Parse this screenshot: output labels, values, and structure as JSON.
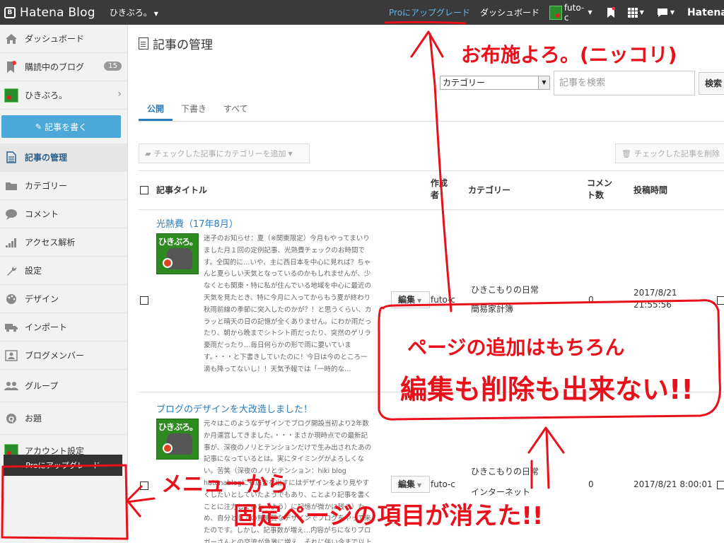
{
  "topbar": {
    "logo": "Hatena Blog",
    "blog_name": "ひきぶろ。",
    "pro_link": "Proにアップグレード",
    "dashboard_link": "ダッシュボード",
    "user": "futo-c",
    "hatena_text": "Hatena"
  },
  "sidebar": {
    "items": [
      {
        "label": "ダッシュボード",
        "icon": "home-icon"
      },
      {
        "label": "購読中のブログ",
        "icon": "bookmark-icon",
        "badge": "15"
      },
      {
        "label": "ひきぶろ。",
        "icon": "blog-avatar-icon"
      },
      {
        "label": "記事の管理",
        "icon": "document-icon"
      },
      {
        "label": "カテゴリー",
        "icon": "folder-icon"
      },
      {
        "label": "コメント",
        "icon": "comment-icon"
      },
      {
        "label": "アクセス解析",
        "icon": "chart-icon"
      },
      {
        "label": "設定",
        "icon": "wrench-icon"
      },
      {
        "label": "デザイン",
        "icon": "palette-icon"
      },
      {
        "label": "インポート",
        "icon": "truck-icon"
      },
      {
        "label": "ブログメンバー",
        "icon": "member-icon"
      },
      {
        "label": "グループ",
        "icon": "group-icon"
      },
      {
        "label": "お題",
        "icon": "question-icon"
      },
      {
        "label": "アカウント設定",
        "icon": "account-avatar-icon"
      }
    ],
    "write_button": "記事を書く",
    "pro_button": "Proにアップグレード"
  },
  "main": {
    "title": "記事の管理",
    "category_select": "カテゴリー",
    "search_placeholder": "記事を検索",
    "search_button": "検索",
    "tabs": [
      "公開",
      "下書き",
      "すべて"
    ],
    "bulk_category": "チェックした記事にカテゴリーを追加",
    "bulk_delete": "チェックした記事を削除",
    "columns": {
      "title": "記事タイトル",
      "author": "作成者",
      "category": "カテゴリー",
      "comments": "コメント数",
      "posted": "投稿時間"
    },
    "rows": [
      {
        "title": "光熱費（17年8月）",
        "excerpt": "迷子のお知らせ：夏（※関東限定）今月もやってまいりました月１回の定例記事、光熱費チェックのお時間です。全国的に…いや、主に西日本を中心に見れば？ちゃんと夏らしい天気となっているのかもしれませんが、少なくとも関東・特に私が住んでいる地域を中心に最近の天気を見たとき、特に今月に入ってからもう夏が終わり秋雨前線の季節に突入したのかが？！と思うくらい、カラッと晴天の日の記憶が全くありません。にわか雨だったり、朝から晩までシトシト雨だったり、突然のゲリラ豪雨だったり…毎日何らかの形で雨に要いています。・・・と下書きしていたのに！今日は今のところ一滴も降ってないし！！天気予報では「一時的な…",
        "edit": "編集",
        "author": "futo-c",
        "category1": "ひきこもりの日常",
        "category2": "簡易家計簿",
        "comments": "0",
        "date": "2017/8/21",
        "time": "21:55:56"
      },
      {
        "title": "ブログのデザインを大改造しました！",
        "excerpt": "元々はこのようなデザインでブログ開設当初より2年数か月運営してきました。・・・まさか現時点での最新記事が、深夜のノリとテンションだけで生み出されたあの記事になっているとは。実にタイミングがよろしくない。苦笑（深夜のノリとテンション：hiki blog hatenablogにも広告を出すにはデザインをより見やすくしたいとしていたようでもあり、ことより記事を書くことに注力していた（よう）に記憶が微かに残る）ため、自分としての無機質なデザインでブログをやって来たのです。しかし、記事数が増え…内容がちになりブロガーさんとの交流が急激に増え、それに伴い今まで以上も",
        "edit": "編集",
        "author": "futo-c",
        "category1": "ひきこもりの日常",
        "category2": "インターネット",
        "comments": "0",
        "date": "2017/8/21 8:00:01",
        "time": ""
      }
    ]
  },
  "annotations": {
    "top": "お布施よろ。(ニッコリ)",
    "middle_line1": "ページの追加はもちろん",
    "middle_line2": "編集も削除も出来ない!!",
    "bottom_line1": "メニューから",
    "bottom_line2": "固定ページの項目が消えた!!"
  },
  "colors": {
    "topbar_bg": "#3a3a3a",
    "accent": "#2b7bb9",
    "write_button": "#4ca8d8",
    "annotation": "#e8111b"
  }
}
